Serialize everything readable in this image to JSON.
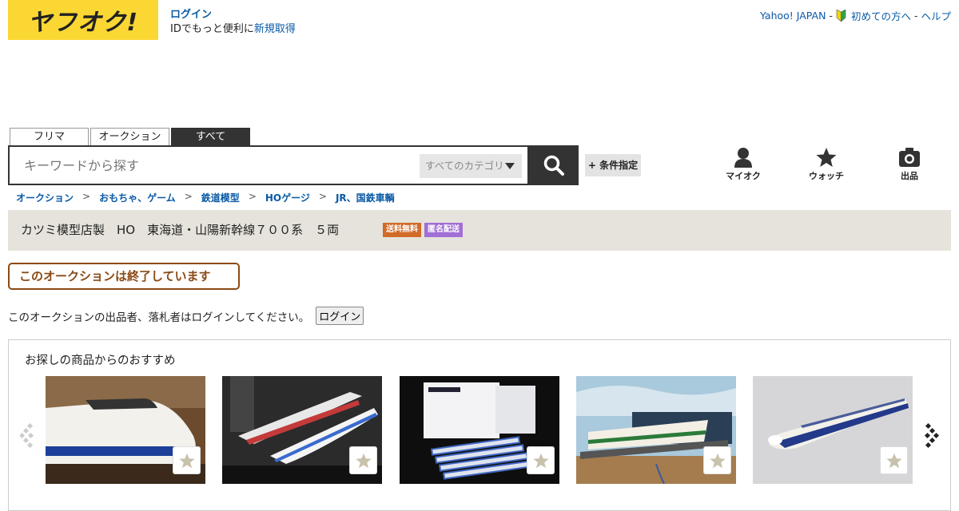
{
  "logo": {
    "text": "ヤフオク!"
  },
  "login": {
    "link": "ログイン",
    "line2_prefix": "IDでもっと便利に",
    "register": "新規取得"
  },
  "top_links": {
    "yahoo": "Yahoo! JAPAN",
    "sep1": "-",
    "first": "初めての方へ",
    "sep2": "-",
    "help": "ヘルプ"
  },
  "tabs": [
    {
      "label": "フリマ"
    },
    {
      "label": "オークション"
    },
    {
      "label": "すべて"
    }
  ],
  "search": {
    "placeholder": "キーワードから探す",
    "category": "すべてのカテゴリ",
    "condition_button": "+ 条件指定"
  },
  "nav_icons": {
    "myauc": "マイオク",
    "watch": "ウォッチ",
    "sell": "出品"
  },
  "breadcrumb": [
    "オークション",
    "おもちゃ、ゲーム",
    "鉄道模型",
    "HOゲージ",
    "JR、国鉄車輌"
  ],
  "breadcrumb_sep": ">",
  "item": {
    "title": "カツミ模型店製　HO　東海道・山陽新幹線７００系　５両",
    "badge_free": "送料無料",
    "badge_anon": "匿名配送"
  },
  "status": {
    "ended": "このオークションは終了しています"
  },
  "notice": {
    "text": "このオークションの出品者、落札者はログインしてください。",
    "button": "ログイン"
  },
  "recommend": {
    "heading": "お探しの商品からのおすすめ"
  },
  "colors": {
    "brand_yellow": "#fbd733",
    "link": "#0a5aa6",
    "dark": "#333333",
    "band": "#e5e3db",
    "ended_border": "#8a4a14",
    "free_badge": "#d26a28",
    "anon_badge": "#a16fd6"
  }
}
